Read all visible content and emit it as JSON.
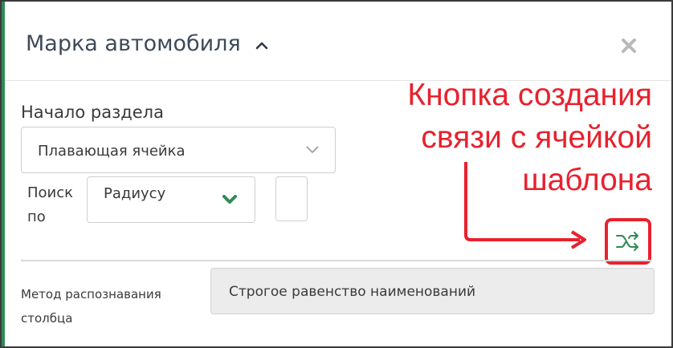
{
  "panel": {
    "title": "Марка автомобиля",
    "close_icon": "close-icon"
  },
  "section": {
    "label": "Начало раздела",
    "select_value": "Плавающая ячейка"
  },
  "search": {
    "label": "Поиск по",
    "select_value": "Радиусу"
  },
  "annotation": {
    "lines": [
      "Кнопка создания",
      "связи с ячейкой",
      "шаблона"
    ],
    "color": "#e8212e"
  },
  "method": {
    "label": "Метод распознавания столбца",
    "value": "Строгое равенство наименований"
  },
  "colors": {
    "accent": "#2e8b57",
    "highlight": "#e8212e"
  }
}
